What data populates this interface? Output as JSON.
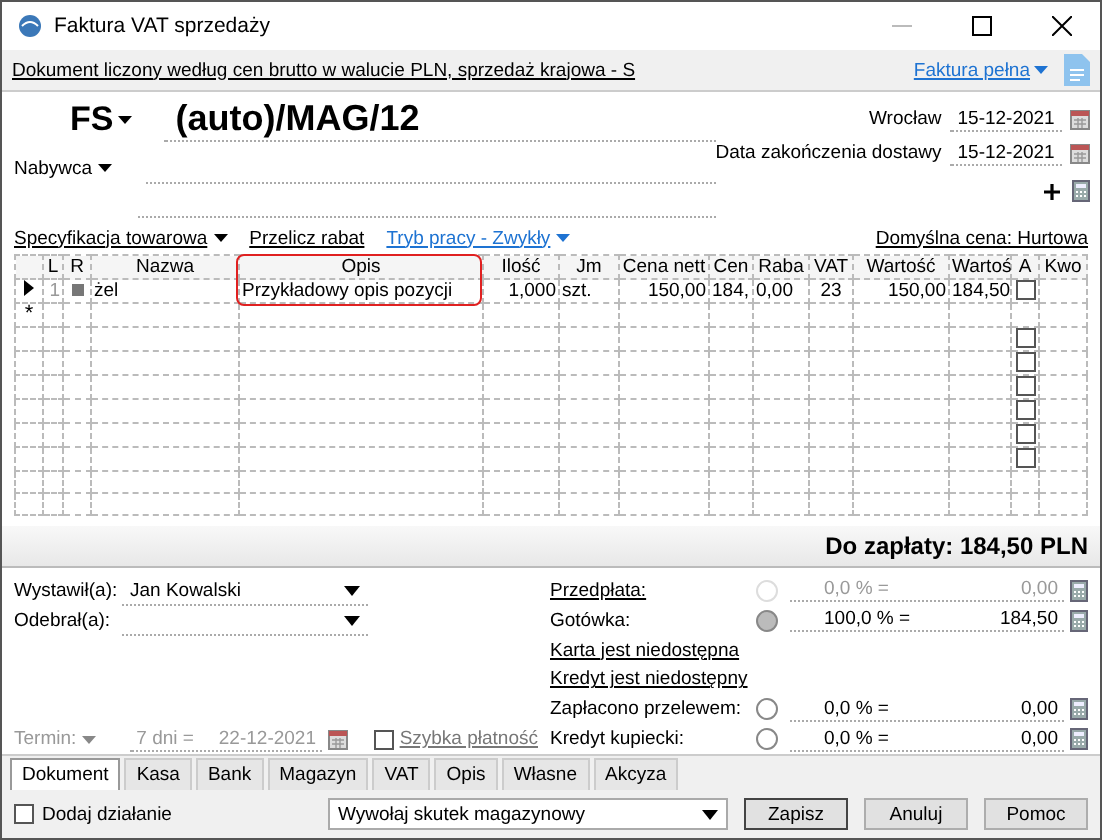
{
  "window": {
    "title": "Faktura VAT sprzedaży"
  },
  "info_bar": {
    "text": "Dokument liczony według cen brutto w walucie PLN, sprzedaż krajowa - S",
    "invoice_type": "Faktura pełna"
  },
  "header": {
    "doc_type": "FS",
    "number": "(auto)/MAG/12",
    "place_label": "Wrocław",
    "place_date": "15-12-2021",
    "delivery_label": "Data zakończenia dostawy",
    "delivery_date": "15-12-2021",
    "buyer_label": "Nabywca"
  },
  "toolbar": {
    "spec": "Specyfikacja towarowa",
    "rabat": "Przelicz rabat",
    "mode": "Tryb pracy - Zwykły",
    "default_price": "Domyślna cena: Hurtowa"
  },
  "table": {
    "columns": [
      {
        "label": "L",
        "highlighted": false
      },
      {
        "label": "R",
        "highlighted": false
      },
      {
        "label": "Nazwa",
        "highlighted": false
      },
      {
        "label": "Opis",
        "highlighted": true
      },
      {
        "label": "Ilość",
        "highlighted": false
      },
      {
        "label": "Jm",
        "highlighted": false
      },
      {
        "label": "Cena nett",
        "highlighted": false
      },
      {
        "label": "Cen",
        "highlighted": false
      },
      {
        "label": "Raba",
        "highlighted": false
      },
      {
        "label": "VAT",
        "highlighted": false
      },
      {
        "label": "Wartość",
        "highlighted": false
      },
      {
        "label": "Wartoś",
        "highlighted": false
      },
      {
        "label": "A",
        "highlighted": false
      },
      {
        "label": "Kwo",
        "highlighted": false
      }
    ],
    "rows": [
      {
        "current": true,
        "lp": "1",
        "name": "żel",
        "description": "Przykładowy opis pozycji",
        "qty": "1,000",
        "unit": "szt.",
        "net_price": "150,00",
        "gross_price": "184,",
        "discount": "0,00",
        "vat": "23",
        "net_value": "150,00",
        "gross_value": "184,50",
        "a_checked": false
      }
    ],
    "new_row_marker": "*",
    "blank_rows": [
      {
        "a_checked": false
      },
      {
        "a_checked": false
      },
      {
        "a_checked": false
      },
      {
        "a_checked": false
      },
      {
        "a_checked": false
      },
      {
        "a_checked": false
      }
    ]
  },
  "total": "Do zapłaty: 184,50 PLN",
  "people": [
    {
      "label": "Wystawił(a):",
      "value": "Jan Kowalski"
    },
    {
      "label": "Odebrał(a):"
    }
  ],
  "term": {
    "label": "Termin:",
    "days": "7 dni =",
    "date": "22-12-2021",
    "disabled": true,
    "fast_payment": {
      "label": "Szybka płatność",
      "checked": false
    }
  },
  "payments": [
    {
      "kind": "amount",
      "label": "Przedpłata:",
      "link": true,
      "disabled": true,
      "selected": false,
      "percent": "0,0 % =",
      "amount": "0,00"
    },
    {
      "kind": "amount",
      "label": "Gotówka:",
      "link": false,
      "disabled": false,
      "selected": true,
      "percent": "100,0 % =",
      "amount": "184,50"
    },
    {
      "kind": "link",
      "label": "Karta jest niedostępna"
    },
    {
      "kind": "link",
      "label": "Kredyt jest niedostępny"
    },
    {
      "kind": "amount",
      "label": "Zapłacono przelewem:",
      "link": false,
      "disabled": false,
      "selected": false,
      "percent": "0,0 % =",
      "amount": "0,00"
    },
    {
      "kind": "amount",
      "label": "Kredyt kupiecki:",
      "link": false,
      "disabled": false,
      "selected": false,
      "percent": "0,0 % =",
      "amount": "0,00"
    }
  ],
  "tabs": [
    {
      "label": "Dokument",
      "selected": true
    },
    {
      "label": "Kasa",
      "selected": false
    },
    {
      "label": "Bank",
      "selected": false
    },
    {
      "label": "Magazyn",
      "selected": false
    },
    {
      "label": "VAT",
      "selected": false
    },
    {
      "label": "Opis",
      "selected": false
    },
    {
      "label": "Własne",
      "selected": false
    },
    {
      "label": "Akcyza",
      "selected": false
    }
  ],
  "footer": {
    "add_action": {
      "label": "Dodaj działanie",
      "checked": false
    },
    "effect": "Wywołaj skutek magazynowy",
    "buttons": [
      {
        "label": "Zapisz",
        "default": true
      },
      {
        "label": "Anuluj",
        "default": false
      },
      {
        "label": "Pomoc",
        "default": false
      }
    ]
  }
}
